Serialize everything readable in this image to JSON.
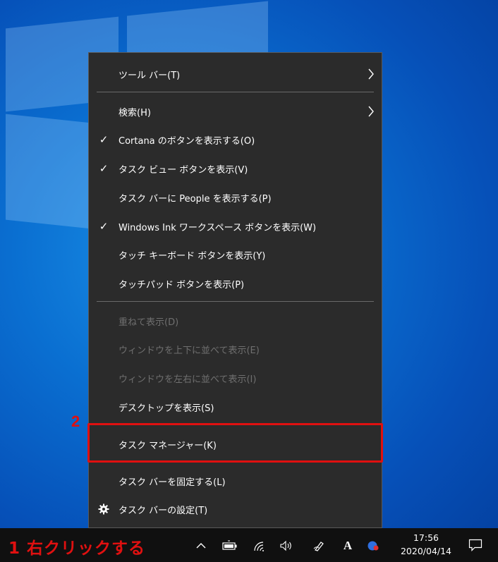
{
  "menu": {
    "items": [
      {
        "label": "ツール バー(T)",
        "checked": false,
        "submenu": true,
        "disabled": false
      },
      {
        "label": "検索(H)",
        "checked": false,
        "submenu": true,
        "disabled": false
      },
      {
        "label": "Cortana のボタンを表示する(O)",
        "checked": true,
        "submenu": false,
        "disabled": false
      },
      {
        "label": "タスク ビュー ボタンを表示(V)",
        "checked": true,
        "submenu": false,
        "disabled": false
      },
      {
        "label": "タスク バーに People を表示する(P)",
        "checked": false,
        "submenu": false,
        "disabled": false
      },
      {
        "label": "Windows Ink ワークスペース ボタンを表示(W)",
        "checked": true,
        "submenu": false,
        "disabled": false
      },
      {
        "label": "タッチ キーボード ボタンを表示(Y)",
        "checked": false,
        "submenu": false,
        "disabled": false
      },
      {
        "label": "タッチパッド ボタンを表示(P)",
        "checked": false,
        "submenu": false,
        "disabled": false
      },
      {
        "label": "重ねて表示(D)",
        "checked": false,
        "submenu": false,
        "disabled": true
      },
      {
        "label": "ウィンドウを上下に並べて表示(E)",
        "checked": false,
        "submenu": false,
        "disabled": true
      },
      {
        "label": "ウィンドウを左右に並べて表示(I)",
        "checked": false,
        "submenu": false,
        "disabled": true
      },
      {
        "label": "デスクトップを表示(S)",
        "checked": false,
        "submenu": false,
        "disabled": false
      },
      {
        "label": "タスク マネージャー(K)",
        "checked": false,
        "submenu": false,
        "disabled": false
      },
      {
        "label": "タスク バーを固定する(L)",
        "checked": false,
        "submenu": false,
        "disabled": false
      },
      {
        "label": "タスク バーの設定(T)",
        "checked": false,
        "submenu": false,
        "disabled": false,
        "icon": "gear-icon"
      }
    ]
  },
  "annotations": {
    "step1": "1 右クリックする",
    "step2": "2"
  },
  "taskbar": {
    "time": "17:56",
    "date": "2020/04/14",
    "ime_label": "A",
    "tray_icons": [
      "chevron-up-icon",
      "battery-icon",
      "wifi-icon",
      "volume-icon",
      "pen-icon",
      "ime-icon",
      "app-icon",
      "notification-icon"
    ]
  },
  "colors": {
    "menu_bg": "#2b2b2b",
    "annotation_red": "#e01010",
    "taskbar_bg": "#101010"
  }
}
